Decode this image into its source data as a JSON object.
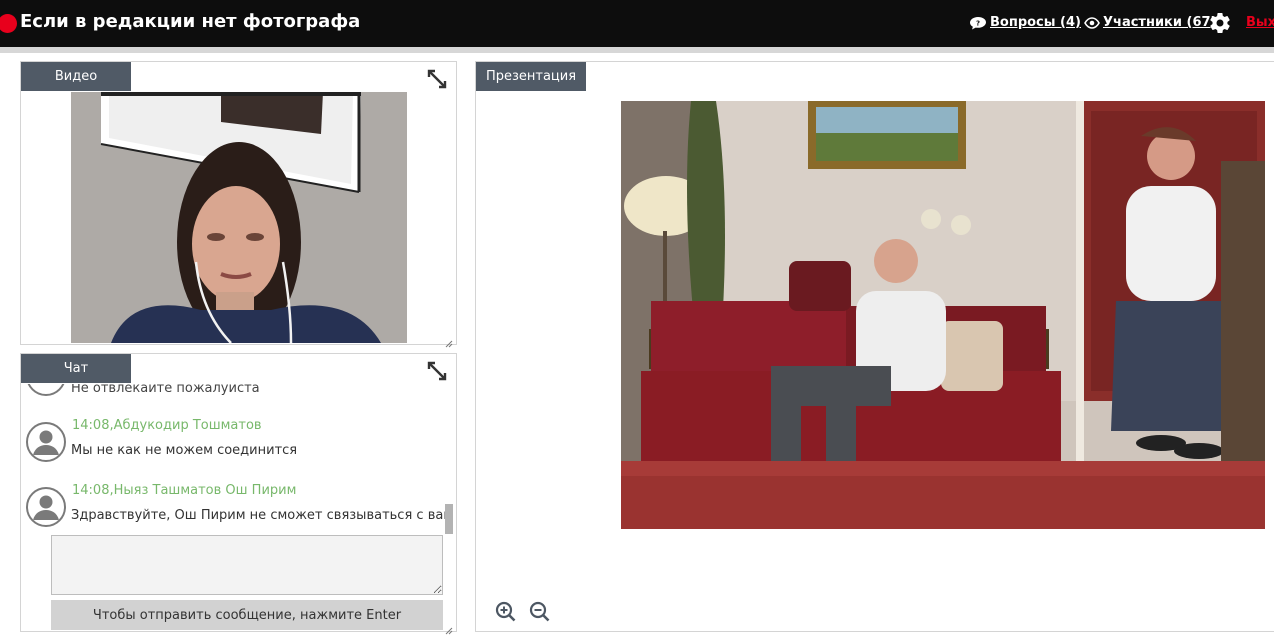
{
  "header": {
    "title": "Если в редакции нет фотографа",
    "questions_label": "Вопросы (4)",
    "participants_label": "Участники (67)",
    "exit_label": "Выход",
    "live_color": "#e8001c",
    "icons": {
      "questions": "speech-bubble-icon",
      "participants": "eye-icon",
      "settings": "gear-icon"
    }
  },
  "video_panel": {
    "tab_label": "Видео",
    "expand_icon": "expand-icon",
    "content": "webcam-feed"
  },
  "chat_panel": {
    "tab_label": "Чат",
    "expand_icon": "expand-icon",
    "partial_message": "Не отвлекайте пожалуйста",
    "messages": [
      {
        "time": "14:08,",
        "author": "Абдукодир Тошматов",
        "text": "Мы не как не можем соединится"
      },
      {
        "time": "14:08,",
        "author": "Ныяз Ташматов Ош Пирим",
        "text": "Здравствуйте, Ош Пирим не сможет связываться с вами"
      }
    ],
    "input_value": "",
    "send_hint": "Чтобы отправить сообщение, нажмите Enter"
  },
  "presentation_panel": {
    "tab_label": "Презентация",
    "slide": "photo-elderly-couple-living-room",
    "zoom_in_icon": "zoom-in-icon",
    "zoom_out_icon": "zoom-out-icon"
  },
  "colors": {
    "topbar_bg": "#0d0d0d",
    "tab_bg": "#505a66",
    "author_green": "#78b86b",
    "exit_red": "#e8001c"
  }
}
